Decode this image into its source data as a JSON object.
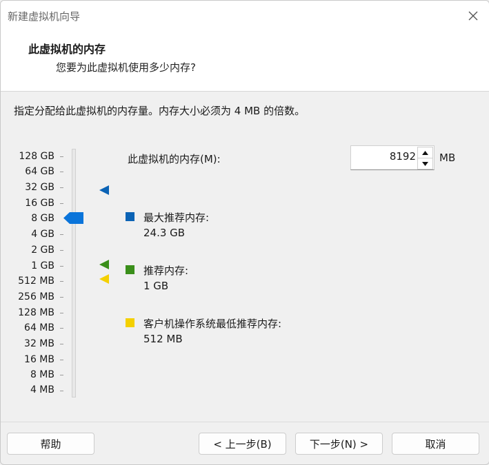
{
  "window": {
    "title": "新建虚拟机向导"
  },
  "header": {
    "title": "此虚拟机的内存",
    "subtitle": "您要为此虚拟机使用多少内存?"
  },
  "description": "指定分配给此虚拟机的内存量。内存大小必须为 4 MB 的倍数。",
  "scale": {
    "ticks": [
      "128 GB",
      "64 GB",
      "32 GB",
      "16 GB",
      "8 GB",
      "4 GB",
      "2 GB",
      "1 GB",
      "512 MB",
      "256 MB",
      "128 MB",
      "64 MB",
      "32 MB",
      "16 MB",
      "8 MB",
      "4 MB"
    ],
    "selected": "8 GB"
  },
  "memory": {
    "label": "此虚拟机的内存(M):",
    "value": "8192",
    "unit": "MB"
  },
  "legend": [
    {
      "label": "最大推荐内存:",
      "value": "24.3 GB",
      "color": "#0b63b5"
    },
    {
      "label": "推荐内存:",
      "value": "1 GB",
      "color": "#3a8f1a"
    },
    {
      "label": "客户机操作系统最低推荐内存:",
      "value": "512 MB",
      "color": "#f4d000"
    }
  ],
  "buttons": {
    "help": "帮助",
    "back": "< 上一步(B)",
    "next": "下一步(N) >",
    "cancel": "取消"
  },
  "icons": {
    "close": "close-icon",
    "spin_up": "chevron-up-icon",
    "spin_down": "chevron-down-icon"
  }
}
